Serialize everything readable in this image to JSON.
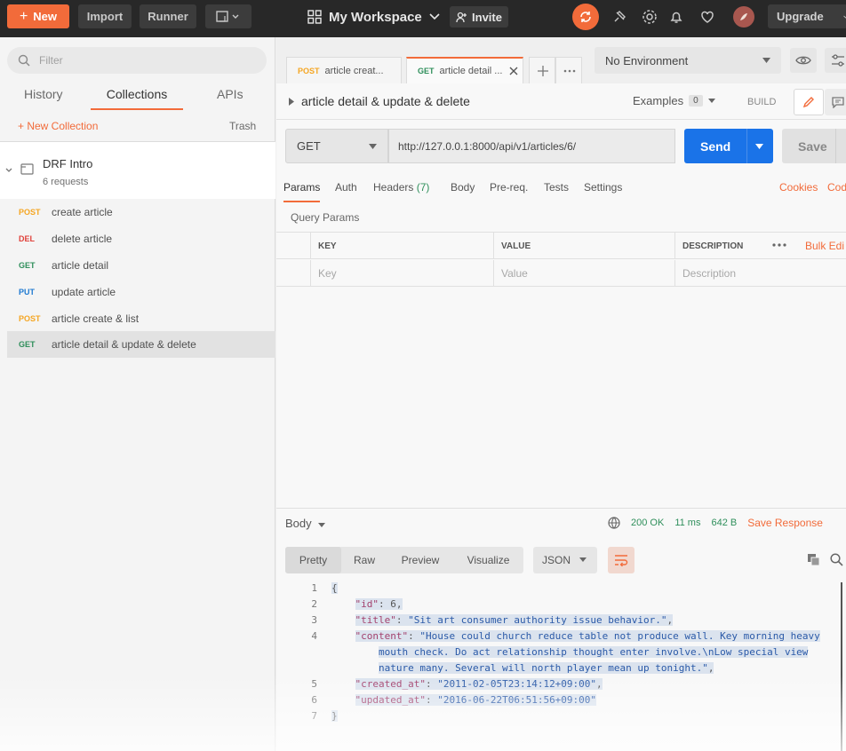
{
  "topbar": {
    "new_label": "New",
    "import_label": "Import",
    "runner_label": "Runner",
    "workspace_label": "My Workspace",
    "invite_label": "Invite",
    "upgrade_label": "Upgrade",
    "accent": "#f26b3a"
  },
  "sidebar": {
    "filter_placeholder": "Filter",
    "tabs": [
      "History",
      "Collections",
      "APIs"
    ],
    "active_tab": "Collections",
    "new_collection_label": "+ New Collection",
    "trash_label": "Trash",
    "collection": {
      "name": "DRF Intro",
      "count": "6 requests"
    },
    "requests": [
      {
        "method": "POST",
        "name": "create article",
        "color": "#f5a623"
      },
      {
        "method": "DEL",
        "name": "delete article",
        "color": "#e0413a"
      },
      {
        "method": "GET",
        "name": "article detail",
        "color": "#2f8f5b"
      },
      {
        "method": "PUT",
        "name": "update article",
        "color": "#1f7ad1"
      },
      {
        "method": "POST",
        "name": "article create & list",
        "color": "#f5a623"
      },
      {
        "method": "GET",
        "name": "article detail & update & delete",
        "color": "#2f8f5b"
      }
    ]
  },
  "tabs": [
    {
      "method": "POST",
      "label": "article creat..."
    },
    {
      "method": "GET",
      "label": "article detail ..."
    }
  ],
  "environment": "No Environment",
  "request": {
    "title": "article detail & update & delete",
    "examples_label": "Examples",
    "examples_count": "0",
    "build_label": "BUILD",
    "method": "GET",
    "url": "http://127.0.0.1:8000/api/v1/articles/6/",
    "send_label": "Send",
    "save_label": "Save",
    "param_tabs": [
      "Params",
      "Auth",
      "Headers",
      "Body",
      "Pre-req.",
      "Tests",
      "Settings"
    ],
    "headers_count": "(7)",
    "cookies_label": "Cookies",
    "code_label": "Cod",
    "query_params_label": "Query Params",
    "columns": [
      "KEY",
      "VALUE",
      "DESCRIPTION"
    ],
    "bulk_edit_label": "Bulk Edi",
    "placeholders": {
      "key": "Key",
      "value": "Value",
      "description": "Description"
    }
  },
  "response": {
    "body_label": "Body",
    "status": "200 OK",
    "time": "11 ms",
    "size": "642 B",
    "save_response_label": "Save Response",
    "view_tabs": [
      "Pretty",
      "Raw",
      "Preview",
      "Visualize"
    ],
    "format": "JSON",
    "lines": [
      {
        "n": "1",
        "parts": [
          {
            "t": "{",
            "c": "n"
          }
        ]
      },
      {
        "n": "2",
        "parts": [
          {
            "t": "    ",
            "c": "n"
          },
          {
            "t": "\"id\"",
            "c": "k"
          },
          {
            "t": ": 6,",
            "c": "n"
          }
        ]
      },
      {
        "n": "3",
        "parts": [
          {
            "t": "    ",
            "c": "n"
          },
          {
            "t": "\"title\"",
            "c": "k"
          },
          {
            "t": ": ",
            "c": "n"
          },
          {
            "t": "\"Sit art consumer authority issue behavior.\"",
            "c": "s"
          },
          {
            "t": ",",
            "c": "n"
          }
        ]
      },
      {
        "n": "4",
        "parts": [
          {
            "t": "    ",
            "c": "n"
          },
          {
            "t": "\"content\"",
            "c": "k"
          },
          {
            "t": ": ",
            "c": "n"
          },
          {
            "t": "\"House could church reduce table not produce wall. Key morning heavy",
            "c": "s"
          }
        ]
      },
      {
        "n": "",
        "parts": [
          {
            "t": "        ",
            "c": "n"
          },
          {
            "t": "mouth check. Do act relationship thought enter involve.\\nLow special view",
            "c": "s"
          }
        ]
      },
      {
        "n": "",
        "parts": [
          {
            "t": "        ",
            "c": "n"
          },
          {
            "t": "nature many. Several will north player mean up tonight.\"",
            "c": "s"
          },
          {
            "t": ",",
            "c": "n"
          }
        ]
      },
      {
        "n": "5",
        "parts": [
          {
            "t": "    ",
            "c": "n"
          },
          {
            "t": "\"created_at\"",
            "c": "k"
          },
          {
            "t": ": ",
            "c": "n"
          },
          {
            "t": "\"2011-02-05T23:14:12+09:00\"",
            "c": "s"
          },
          {
            "t": ",",
            "c": "n"
          }
        ]
      },
      {
        "n": "6",
        "parts": [
          {
            "t": "    ",
            "c": "n"
          },
          {
            "t": "\"updated_at\"",
            "c": "k"
          },
          {
            "t": ": ",
            "c": "n"
          },
          {
            "t": "\"2016-06-22T06:51:56+09:00\"",
            "c": "s"
          }
        ]
      },
      {
        "n": "7",
        "parts": [
          {
            "t": "}",
            "c": "n"
          }
        ]
      }
    ]
  }
}
